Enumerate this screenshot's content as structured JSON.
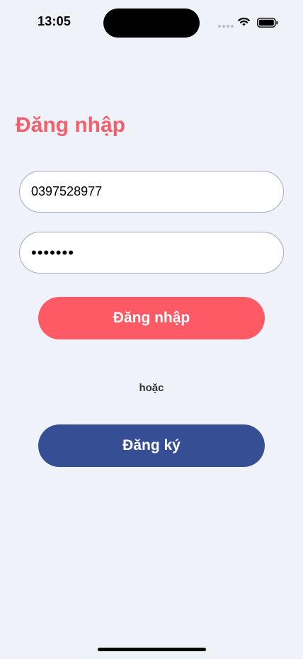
{
  "status_bar": {
    "time": "13:05"
  },
  "login": {
    "title": "Đăng nhập",
    "phone_value": "0397528977",
    "password_value": "•••••••",
    "login_button_label": "Đăng nhập",
    "or_label": "hoặc",
    "register_button_label": "Đăng ký"
  },
  "colors": {
    "title": "#f2606d",
    "login_button": "#fd5a66",
    "register_button": "#354e94",
    "background": "#eff2f8"
  }
}
